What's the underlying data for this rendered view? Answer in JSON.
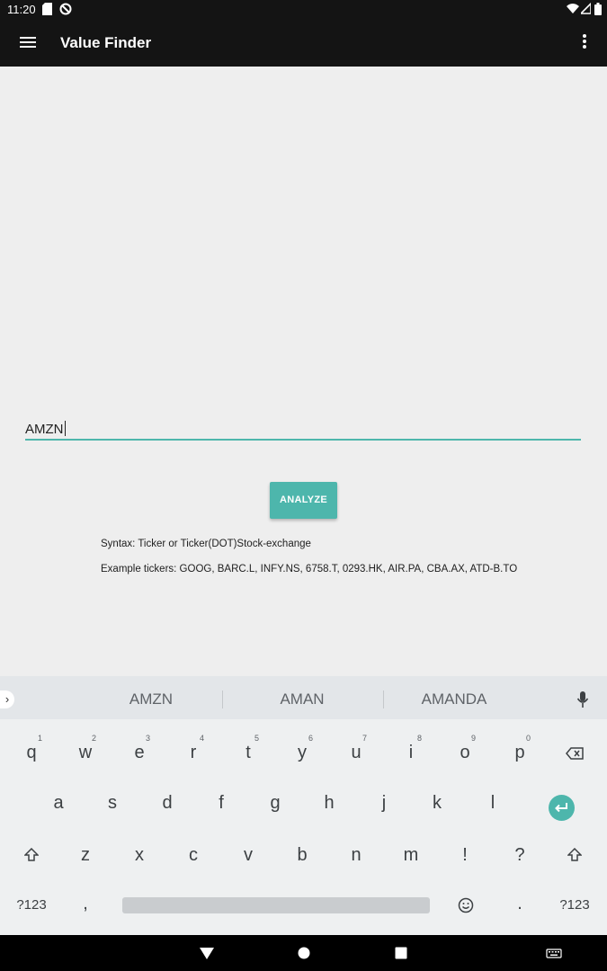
{
  "status_bar": {
    "time": "11:20"
  },
  "app_bar": {
    "title": "Value Finder",
    "menu_icon": "hamburger-menu-icon",
    "overflow_icon": "more-vert-icon"
  },
  "ticker_input": {
    "value": "AMZN"
  },
  "analyze_button": {
    "label": "ANALYZE"
  },
  "hints": {
    "syntax": "Syntax: Ticker or Ticker(DOT)Stock-exchange",
    "examples": "Example tickers: GOOG, BARC.L, INFY.NS, 6758.T, 0293.HK, AIR.PA, CBA.AX, ATD-B.TO"
  },
  "keyboard": {
    "suggestions": [
      "AMZN",
      "AMAN",
      "AMANDA"
    ],
    "row1": [
      {
        "key": "q",
        "hint": "1"
      },
      {
        "key": "w",
        "hint": "2"
      },
      {
        "key": "e",
        "hint": "3"
      },
      {
        "key": "r",
        "hint": "4"
      },
      {
        "key": "t",
        "hint": "5"
      },
      {
        "key": "y",
        "hint": "6"
      },
      {
        "key": "u",
        "hint": "7"
      },
      {
        "key": "i",
        "hint": "8"
      },
      {
        "key": "o",
        "hint": "9"
      },
      {
        "key": "p",
        "hint": "0"
      }
    ],
    "row2": [
      "a",
      "s",
      "d",
      "f",
      "g",
      "h",
      "j",
      "k",
      "l"
    ],
    "row3": [
      "z",
      "x",
      "c",
      "v",
      "b",
      "n",
      "m",
      "!",
      "?"
    ],
    "row4": {
      "symbols_left": "?123",
      "comma": ",",
      "period": ".",
      "symbols_right": "?123"
    }
  },
  "colors": {
    "accent": "#4db6ac",
    "app_bar": "#141414",
    "background": "#eeeeee"
  }
}
